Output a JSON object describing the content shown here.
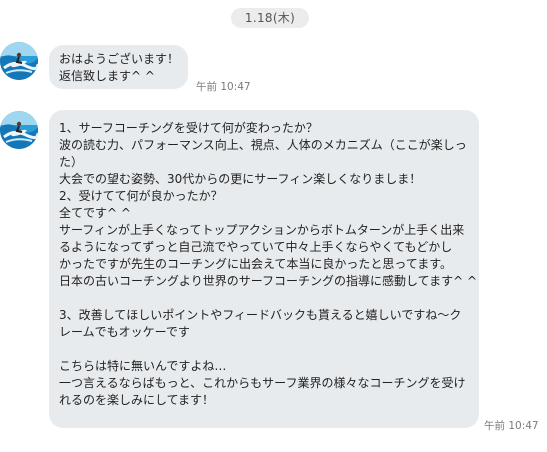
{
  "date_label": "1.18(木)",
  "messages": [
    {
      "lines": [
        "おはようございます！",
        "返信致します^ ^"
      ],
      "time": "午前 10:47"
    },
    {
      "lines": [
        "1、サーフコーチングを受けて何が変わったか？",
        "波の読む力、パフォーマンス向上、視点、人体のメカニズム（ここが楽しっ",
        "た）",
        "大会での望む姿勢、30代からの更にサーフィン楽しくなりましま！",
        "2、受けてて何が良かったか？",
        "全てです^ ^",
        "サーフィンが上手くなってトップアクションからボトムターンが上手く出来",
        "るようになってずっと自己流でやっていて中々上手くならやくてもどかし",
        "かったですが先生のコーチングに出会えて本当に良かったと思ってます。",
        "日本の古いコーチングより世界のサーフコーチングの指導に感動してます^ ^",
        "",
        "3、改善してほしいポイントやフィードバックも貰えると嬉しいですね〜ク",
        "レームでもオッケーです",
        "",
        "こちらは特に無いんですよね…",
        "一つ言えるならばもっと、これからもサーフ業界の様々なコーチングを受け",
        "れるのを楽しみにしてます！"
      ],
      "time": "午前 10:47"
    }
  ]
}
